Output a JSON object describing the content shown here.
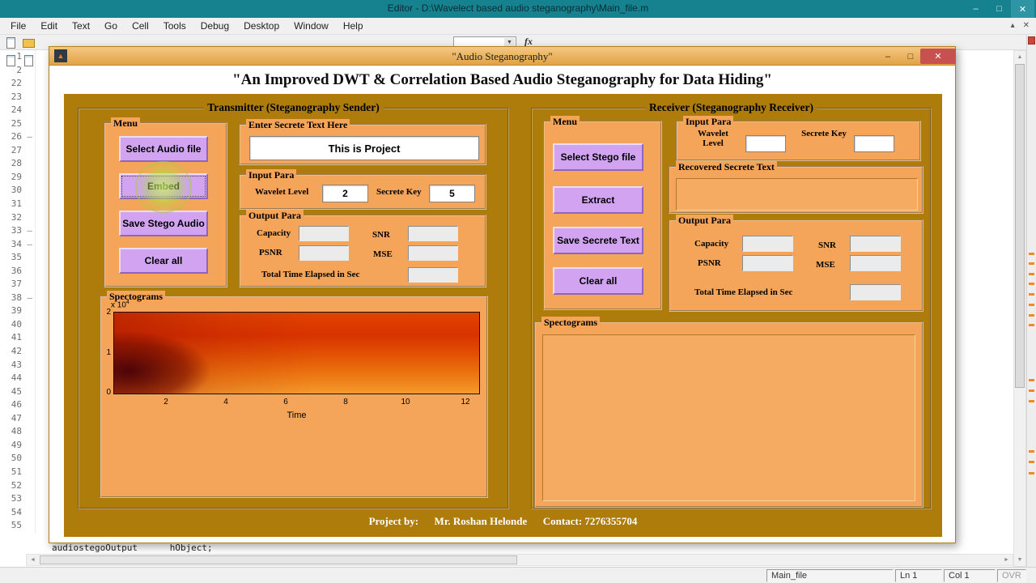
{
  "icons": {
    "minimize": "–",
    "maximize": "□",
    "close": "✕",
    "up_arrow": "▲",
    "down_arrow": "▼",
    "left_arrow": "◄",
    "right_arrow": "►",
    "dropdown_arrow": "▼",
    "collapse": "▴",
    "matlab_logo": "▲",
    "fx": "fx"
  },
  "editor": {
    "window_title": "Editor - D:\\Wavelect based audio steganography\\Main_file.m",
    "menu_items": [
      "File",
      "Edit",
      "Text",
      "Go",
      "Cell",
      "Tools",
      "Debug",
      "Desktop",
      "Window",
      "Help"
    ],
    "lines": [
      "1",
      "2",
      "22",
      "23",
      "24",
      "25",
      "26",
      "27",
      "28",
      "29",
      "30",
      "31",
      "32",
      "33",
      "34",
      "35",
      "36",
      "37",
      "38",
      "39",
      "40",
      "41",
      "42",
      "43",
      "44",
      "45",
      "46",
      "47",
      "48",
      "49",
      "50",
      "51",
      "52",
      "53",
      "54",
      "55"
    ],
    "fold_lines": [
      "26",
      "33",
      "34",
      "38"
    ],
    "code_fragment": "audiostegoOutput      hObject;",
    "lint_marks": [
      312,
      324,
      337,
      349,
      362,
      375,
      388,
      400,
      468,
      481,
      494,
      556,
      569,
      583
    ],
    "statusbar": {
      "file": "Main_file",
      "line": "Ln 1",
      "col": "Col 1",
      "overwrite": "OVR"
    }
  },
  "figure": {
    "title": "\"Audio Steganography\"",
    "heading": "\"An Improved DWT & Correlation Based Audio Steganography for Data Hiding\"",
    "footer": "Project by:      Mr. Roshan Helonde      Contact: 7276355704",
    "transmitter": {
      "title": "Transmitter (Steganography Sender)",
      "menu_title": "Menu",
      "buttons": [
        "Select Audio file",
        "Embed",
        "Save Stego Audio",
        "Clear all"
      ],
      "secret_panel_title": "Enter Secrete Text Here",
      "secret_text": "This is Project",
      "input_para": {
        "title": "Input Para",
        "wavelet_label": "Wavelet Level",
        "wavelet_value": "2",
        "key_label": "Secrete Key",
        "key_value": "5"
      },
      "output_para": {
        "title": "Output Para",
        "capacity": "Capacity",
        "snr": "SNR",
        "psnr": "PSNR",
        "mse": "MSE",
        "time_label": "Total Time Elapsed in Sec",
        "capacity_value": "",
        "snr_value": "",
        "psnr_value": "",
        "mse_value": "",
        "time_value": ""
      },
      "spectrogram": {
        "title": "Spectograms",
        "y_exp_prefix": "x 10",
        "y_exp_sup": "4",
        "y_ticks": [
          "2",
          "1",
          "0"
        ],
        "x_ticks": [
          "2",
          "4",
          "6",
          "8",
          "10",
          "12"
        ],
        "xlabel": "Time"
      }
    },
    "receiver": {
      "title": "Receiver (Steganography Receiver)",
      "menu_title": "Menu",
      "buttons": [
        "Select Stego file",
        "Extract",
        "Save Secrete Text",
        "Clear all"
      ],
      "input_para": {
        "title": "Input Para",
        "wavelet_label": "Wavelet Level",
        "wavelet_value": "",
        "key_label": "Secrete Key",
        "key_value": ""
      },
      "recovered_title": "Recovered Secrete Text",
      "recovered_text": "",
      "output_para": {
        "title": "Output Para",
        "capacity": "Capacity",
        "snr": "SNR",
        "psnr": "PSNR",
        "mse": "MSE",
        "time_label": "Total Time Elapsed in Sec",
        "capacity_value": "",
        "snr_value": "",
        "psnr_value": "",
        "mse_value": "",
        "time_value": ""
      },
      "spectrogram_title": "Spectograms"
    }
  }
}
